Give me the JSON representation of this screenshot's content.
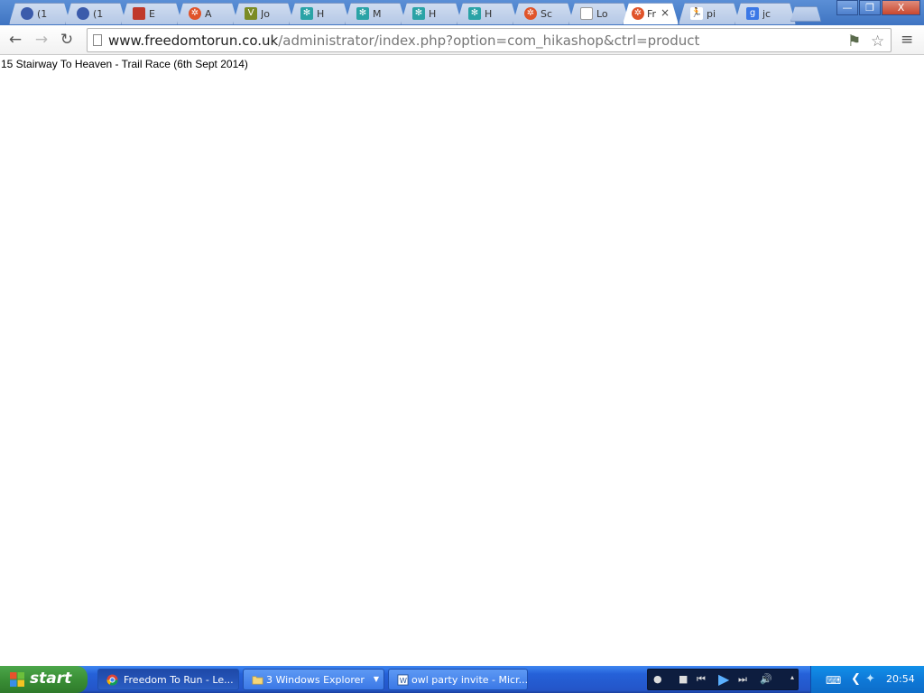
{
  "browser": {
    "tabs": [
      {
        "favicon": "circle-globe-icon",
        "title": "(1",
        "color": "#3b5bab"
      },
      {
        "favicon": "circle-globe-icon",
        "title": "(1",
        "color": "#3b5bab"
      },
      {
        "favicon": "red-bookmark-icon",
        "title": "E",
        "color": "#c0392b"
      },
      {
        "favicon": "joomla-icon",
        "title": "A",
        "color": "#e0542a"
      },
      {
        "favicon": "hikashop-v-icon",
        "title": "Jo",
        "color": "#7b8c25"
      },
      {
        "favicon": "snowflake-icon",
        "title": "H",
        "color": "#2aa3a6"
      },
      {
        "favicon": "snowflake-icon",
        "title": "M",
        "color": "#2aa3a6"
      },
      {
        "favicon": "snowflake-icon",
        "title": "H",
        "color": "#2aa3a6"
      },
      {
        "favicon": "snowflake-icon",
        "title": "H",
        "color": "#2aa3a6"
      },
      {
        "favicon": "joomla-icon",
        "title": "Sc",
        "color": "#e0542a"
      },
      {
        "favicon": "document-icon",
        "title": "Lo",
        "color": "#aaaaaa"
      },
      {
        "favicon": "joomla-icon",
        "title": "Fr",
        "color": "#e0542a",
        "active": true
      },
      {
        "favicon": "runner-icon",
        "title": "pi",
        "color": "#222222"
      },
      {
        "favicon": "google-icon",
        "title": "jc",
        "color": "#3b78e6"
      }
    ],
    "close_tab_glyph": "×",
    "window_controls": {
      "minimize": "—",
      "restore": "❐",
      "close": "X"
    },
    "url_host": "www.freedomtorun.co.uk",
    "url_path": "/administrator/index.php?option=com_hikashop&ctrl=product"
  },
  "page": {
    "text": "15 Stairway To Heaven - Trail Race (6th Sept 2014)"
  },
  "taskbar": {
    "start_label": "start",
    "buttons": [
      {
        "icon": "chrome-icon",
        "label": "Freedom To Run - Le...",
        "active": true
      },
      {
        "icon": "folder-icon",
        "label": "3 Windows Explorer",
        "has_dropdown": true
      },
      {
        "icon": "word-icon",
        "label": "owl party invite - Micr..."
      }
    ],
    "clock": "20:54"
  }
}
